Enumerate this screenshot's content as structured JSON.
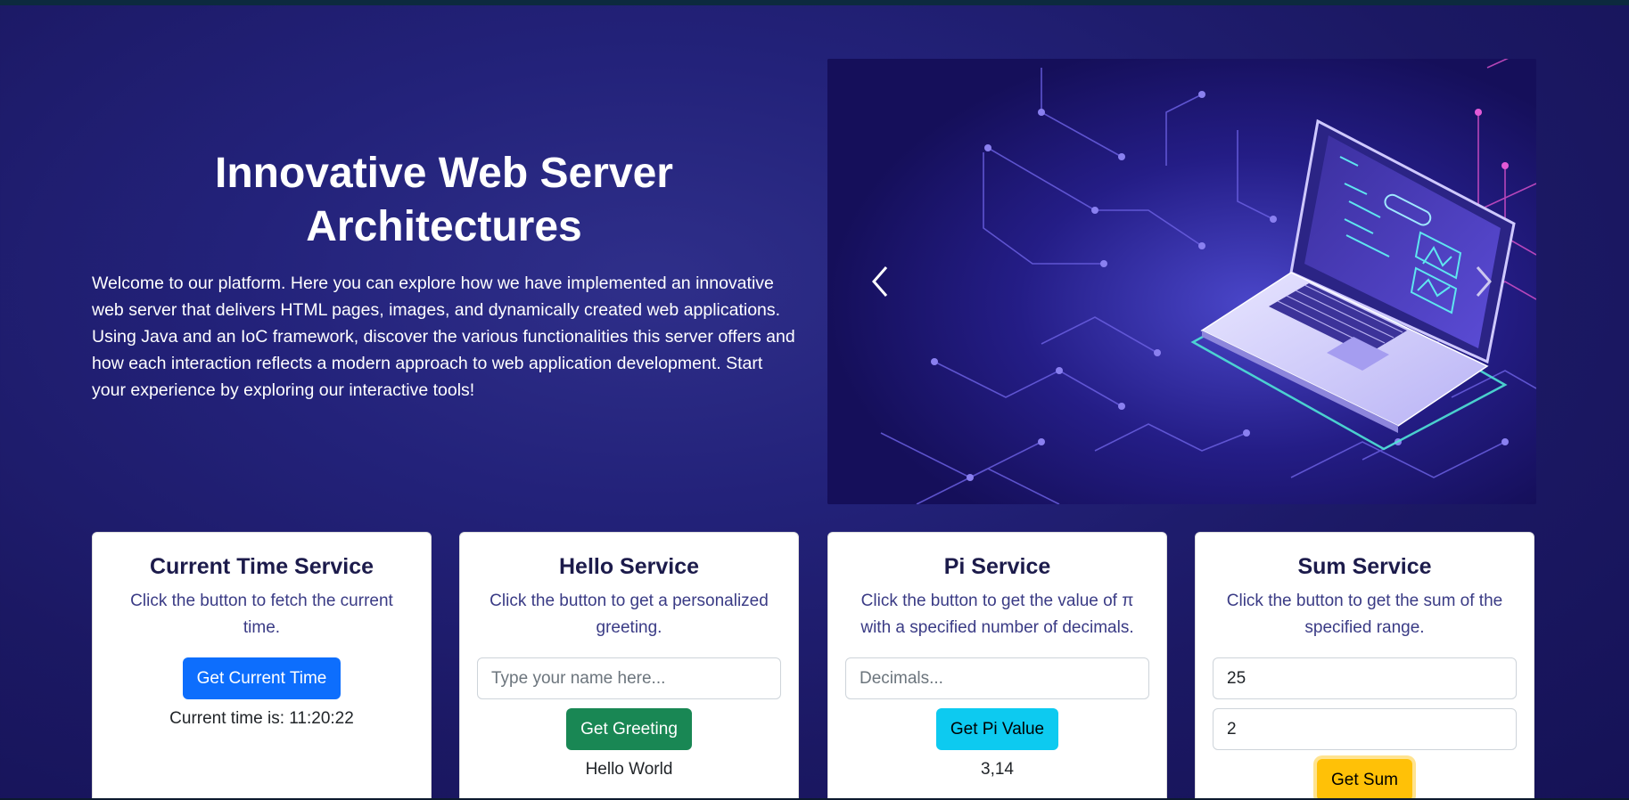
{
  "hero": {
    "title": "Innovative Web Server Architectures",
    "description": "Welcome to our platform. Here you can explore how we have implemented an innovative web server that delivers HTML pages, images, and dynamically created web applications. Using Java and an IoC framework, discover the various functionalities this server offers and how each interaction reflects a modern approach to web application development. Start your experience by exploring our interactive tools!"
  },
  "carousel": {
    "prev_icon": "chevron-left-icon",
    "next_icon": "chevron-right-icon",
    "slide_image": "laptop-circuit-illustration"
  },
  "cards": {
    "time": {
      "title": "Current Time Service",
      "text": "Click the button to fetch the current time.",
      "button": "Get Current Time",
      "result": "Current time is: 11:20:22"
    },
    "hello": {
      "title": "Hello Service",
      "text": "Click the button to get a personalized greeting.",
      "input_placeholder": "Type your name here...",
      "input_value": "",
      "button": "Get Greeting",
      "result": "Hello World"
    },
    "pi": {
      "title": "Pi Service",
      "text": "Click the button to get the value of π with a specified number of decimals.",
      "input_placeholder": "Decimals...",
      "input_value": "",
      "button": "Get Pi Value",
      "result": "3,14"
    },
    "sum": {
      "title": "Sum Service",
      "text": "Click the button to get the sum of the specified range.",
      "input1_value": "25",
      "input2_value": "2",
      "button": "Get Sum"
    }
  },
  "colors": {
    "background": "#1b1863",
    "primary": "#0d6efd",
    "success": "#198754",
    "info": "#0dcaf0",
    "warning": "#ffc107",
    "card_title": "#1c1b4b",
    "card_text": "#3a3b85"
  }
}
